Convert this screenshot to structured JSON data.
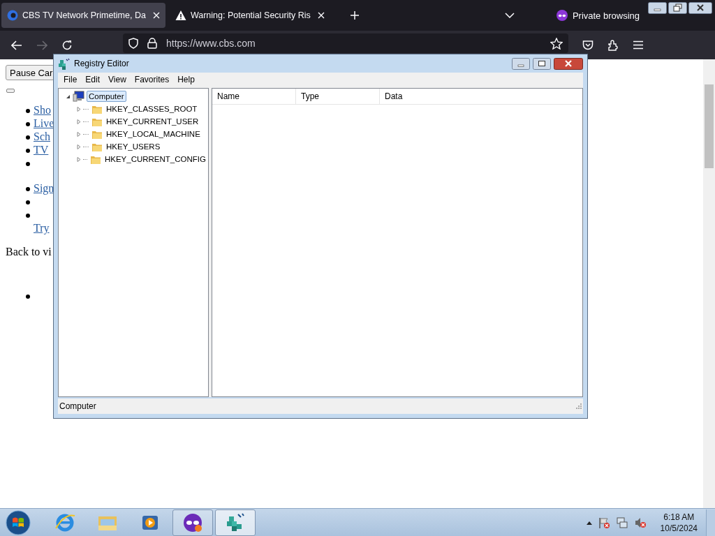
{
  "browser": {
    "tabs": [
      {
        "title": "CBS TV Network Primetime, Da",
        "kind": "site",
        "selected": true
      },
      {
        "title": "Warning: Potential Security Ris",
        "kind": "warning",
        "selected": false
      }
    ],
    "private_label": "Private browsing",
    "url": "https://www.cbs.com",
    "forward_disabled": true
  },
  "web_page": {
    "button": "Pause Car",
    "items": [
      {
        "kind": "link",
        "text": "Sho"
      },
      {
        "kind": "link",
        "text": "Live"
      },
      {
        "kind": "link",
        "text": "Sch"
      },
      {
        "kind": "link",
        "text": "TV"
      },
      {
        "kind": "empty"
      },
      {
        "kind": "gap"
      },
      {
        "kind": "link",
        "text": "Sign"
      },
      {
        "kind": "empty"
      },
      {
        "kind": "line",
        "text": "Try"
      }
    ],
    "paragraph": "Back to vi",
    "after_items": [
      {
        "kind": "empty"
      }
    ]
  },
  "registry_editor": {
    "title": "Registry Editor",
    "menu": [
      "File",
      "Edit",
      "View",
      "Favorites",
      "Help"
    ],
    "tree": {
      "label": "Computer",
      "expanded": true,
      "selected": true,
      "children": [
        {
          "label": "HKEY_CLASSES_ROOT",
          "expanded": false,
          "selected": false
        },
        {
          "label": "HKEY_CURRENT_USER",
          "expanded": false,
          "selected": false
        },
        {
          "label": "HKEY_LOCAL_MACHINE",
          "expanded": false,
          "selected": false
        },
        {
          "label": "HKEY_USERS",
          "expanded": false,
          "selected": false
        },
        {
          "label": "HKEY_CURRENT_CONFIG",
          "expanded": false,
          "selected": false
        }
      ]
    },
    "columns": [
      "Name",
      "Type",
      "Data"
    ],
    "status": "Computer"
  },
  "taskbar": {
    "apps": [
      {
        "kind": "ie",
        "selected": false
      },
      {
        "kind": "explorer",
        "selected": false
      },
      {
        "kind": "media",
        "selected": false
      },
      {
        "kind": "private",
        "selected": false
      },
      {
        "kind": "regedit",
        "selected": true
      }
    ],
    "time": "6:18 AM",
    "date": "10/5/2024"
  }
}
